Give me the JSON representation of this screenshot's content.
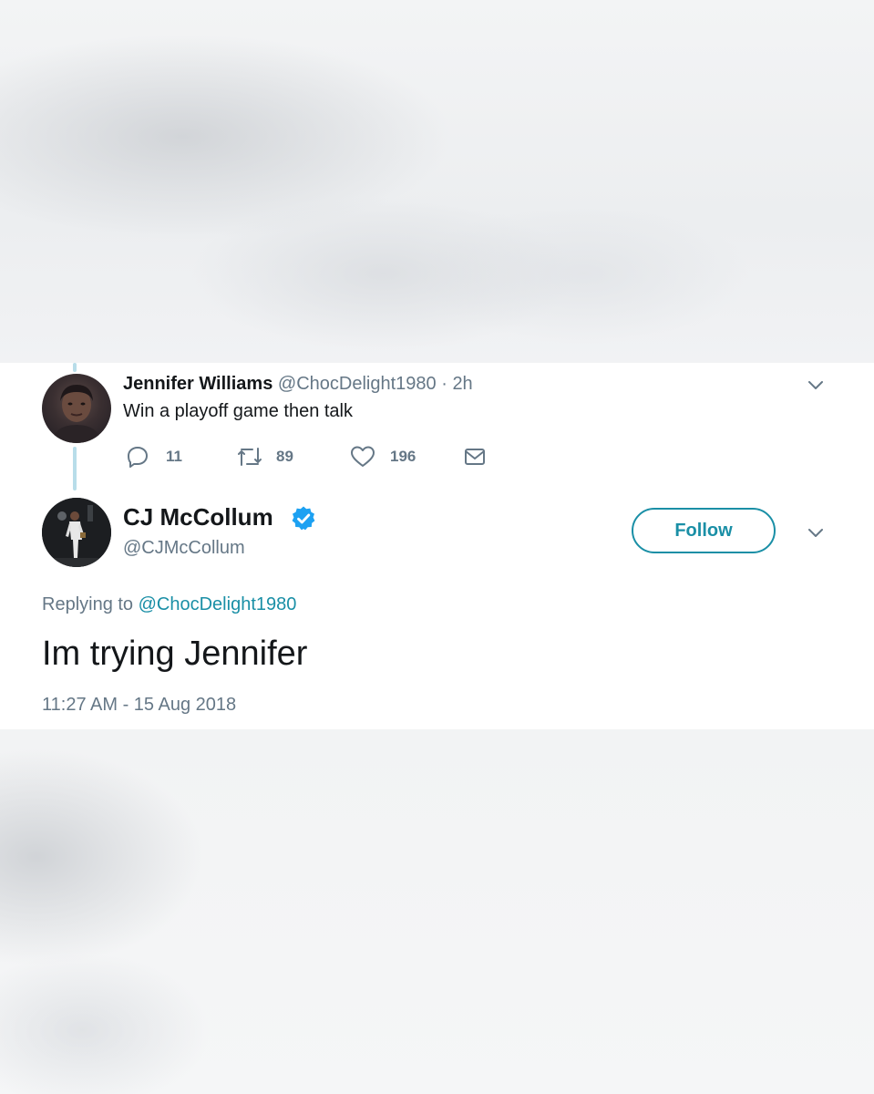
{
  "reply_tweet": {
    "author_name": "Jennifer Williams",
    "author_handle": "@ChocDelight1980",
    "separator": "·",
    "time_ago": "2h",
    "text": "Win a playoff game then talk",
    "actions": {
      "replies": "11",
      "retweets": "89",
      "likes": "196"
    }
  },
  "main_tweet": {
    "author_name": "CJ McCollum",
    "author_handle": "@CJMcCollum",
    "follow_label": "Follow",
    "replying_prefix": "Replying to",
    "replying_to": "@ChocDelight1980",
    "text": "Im trying Jennifer",
    "timestamp": "11:27 AM - 15 Aug 2018"
  },
  "icons": {
    "reply": "reply-icon",
    "retweet": "retweet-icon",
    "like": "heart-icon",
    "dm": "envelope-icon",
    "verified": "verified-badge-icon",
    "menu": "chevron-down-icon"
  },
  "colors": {
    "accent": "#1a8fa6",
    "verified": "#1da1f2",
    "muted_text": "#657786",
    "thread_line": "#b8dde9"
  }
}
